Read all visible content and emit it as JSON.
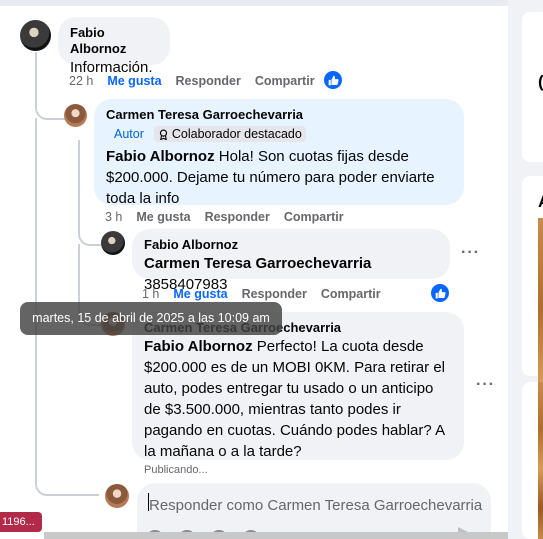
{
  "comments": [
    {
      "author": "Fabio Albornoz",
      "text": "Información.",
      "time": "22 h",
      "like_label": "Me gusta",
      "reply_label": "Responder",
      "share_label": "Compartir"
    },
    {
      "author": "Carmen Teresa Garroechevarria",
      "badge_author": "Autor",
      "badge_collab": "Colaborador destacado",
      "mention": "Fabio Albornoz",
      "text": " Hola! Son cuotas fijas desde $200.000. Dejame tu número para poder enviarte toda la info",
      "time": "3 h",
      "like_label": "Me gusta",
      "reply_label": "Responder",
      "share_label": "Compartir"
    },
    {
      "author": "Fabio Albornoz",
      "mention": "Carmen Teresa Garroechevarria",
      "text": " 3858407983",
      "time": "1 h",
      "like_label": "Me gusta",
      "reply_label": "Responder",
      "share_label": "Compartir"
    },
    {
      "author": "Carmen Teresa Garroechevarria",
      "mention": "Fabio Albornoz",
      "text": " Perfecto! La cuota desde $200.000 es de un MOBI 0KM. Para retirar el auto, podes entregar tu usado o un anticipo de $3.500.000, mientras tanto podes ir pagando en cuotas. Cuándo podes hablar? A la mañana o a la tarde?",
      "status": "Publicando..."
    }
  ],
  "tooltip": "martes, 15 de abril de 2025 a las 10:09 am",
  "reply_input": {
    "placeholder": "Responder como Carmen Teresa Garroechevarria"
  },
  "url_tag": "1196...",
  "more_dots": "···",
  "icons": {
    "like_reaction": "thumbs-up-icon",
    "collab_badge": "badge-icon",
    "more_options": "more-options-icon",
    "send": "send-icon"
  },
  "colors": {
    "accent_blue": "#0866ff",
    "bubble_gray": "#f0f2f5",
    "bubble_blue_highlight": "#e7f3ff",
    "muted_text": "#65676b"
  }
}
